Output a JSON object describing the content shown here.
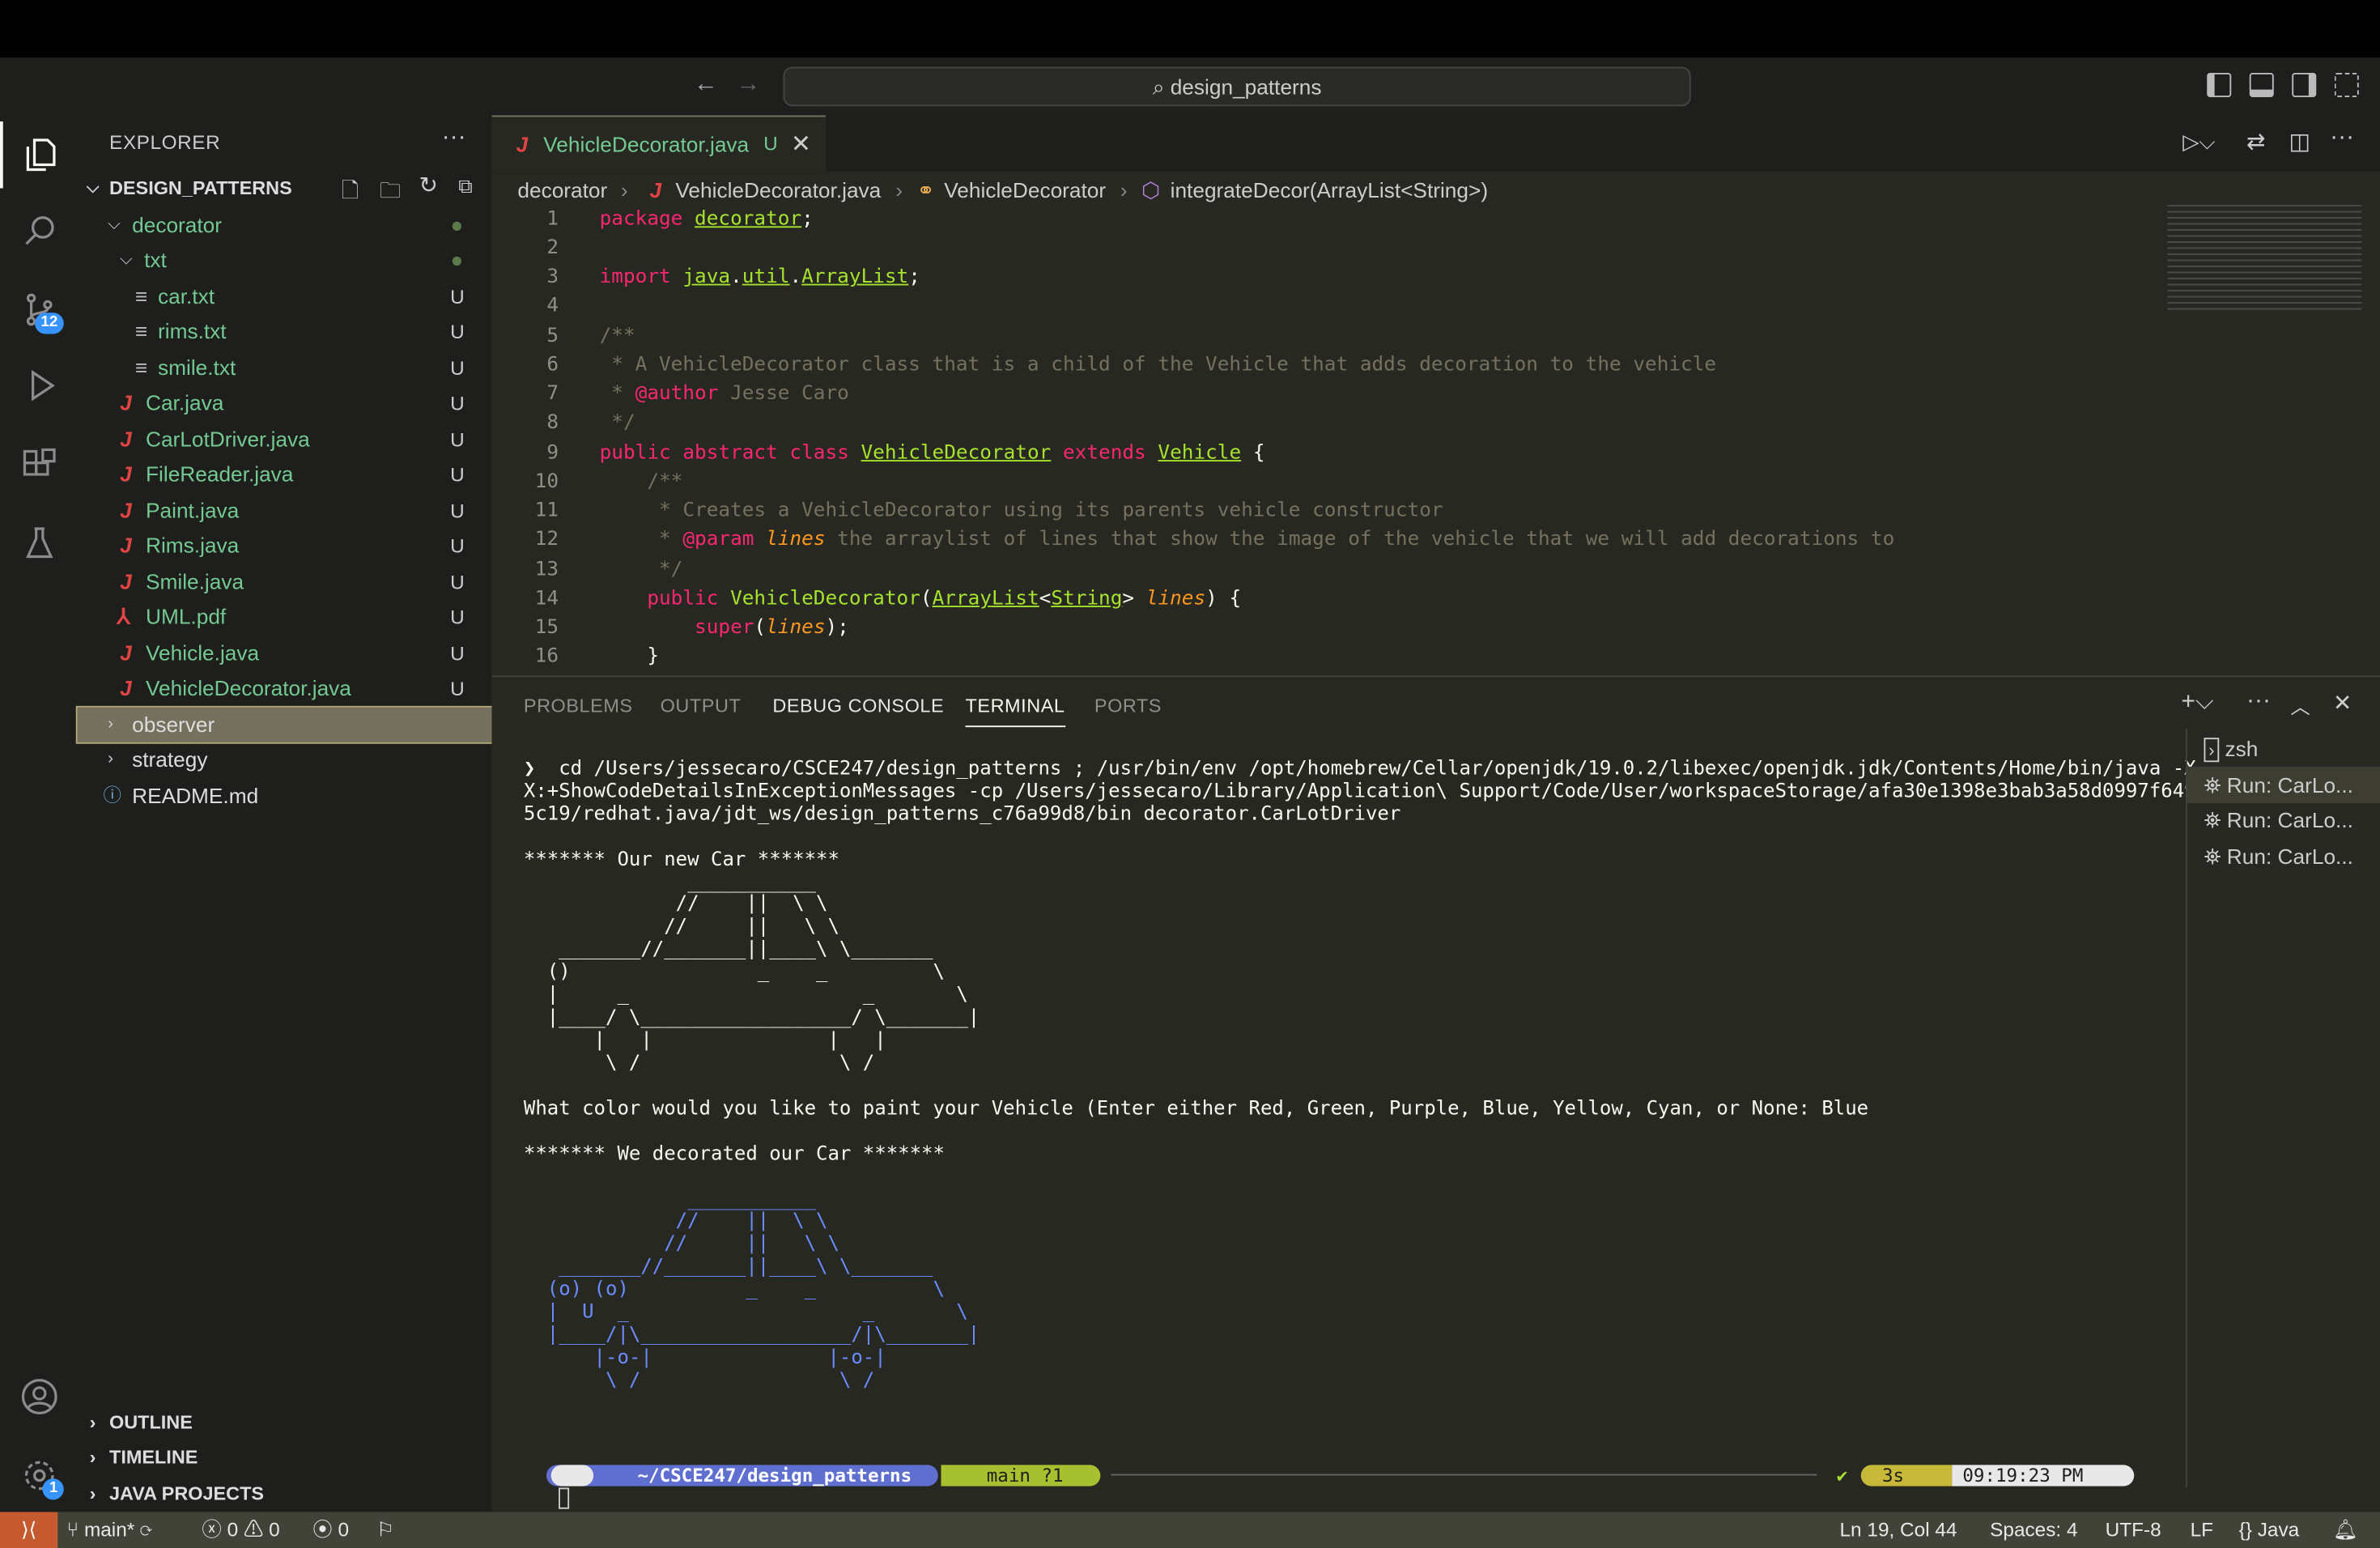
{
  "window": {
    "search": "design_patterns"
  },
  "activity": {
    "scm_badge": "12",
    "settings_badge": "1"
  },
  "sidebar": {
    "title": "EXPLORER",
    "root": "DESIGN_PATTERNS",
    "items": [
      {
        "label": "decorator",
        "status": ""
      },
      {
        "label": "txt",
        "status": ""
      },
      {
        "label": "car.txt",
        "status": "U"
      },
      {
        "label": "rims.txt",
        "status": "U"
      },
      {
        "label": "smile.txt",
        "status": "U"
      },
      {
        "label": "Car.java",
        "status": "U"
      },
      {
        "label": "CarLotDriver.java",
        "status": "U"
      },
      {
        "label": "FileReader.java",
        "status": "U"
      },
      {
        "label": "Paint.java",
        "status": "U"
      },
      {
        "label": "Rims.java",
        "status": "U"
      },
      {
        "label": "Smile.java",
        "status": "U"
      },
      {
        "label": "UML.pdf",
        "status": "U"
      },
      {
        "label": "Vehicle.java",
        "status": "U"
      },
      {
        "label": "VehicleDecorator.java",
        "status": "U"
      },
      {
        "label": "observer",
        "status": ""
      },
      {
        "label": "strategy",
        "status": ""
      },
      {
        "label": "README.md",
        "status": ""
      }
    ],
    "sections": [
      "OUTLINE",
      "TIMELINE",
      "JAVA PROJECTS"
    ]
  },
  "editor": {
    "tab": {
      "label": "VehicleDecorator.java",
      "status": "U"
    },
    "breadcrumb": [
      "decorator",
      "VehicleDecorator.java",
      "VehicleDecorator",
      "integrateDecor(ArrayList<String>)"
    ],
    "line_numbers": [
      "1",
      "2",
      "3",
      "4",
      "5",
      "6",
      "7",
      "8",
      "9",
      "10",
      "11",
      "12",
      "13",
      "14",
      "15",
      "16"
    ]
  },
  "panel": {
    "tabs": [
      "PROBLEMS",
      "OUTPUT",
      "DEBUG CONSOLE",
      "TERMINAL",
      "PORTS"
    ],
    "active_tab": "TERMINAL",
    "terminals": [
      "zsh",
      "Run: CarLo...",
      "Run: CarLo...",
      "Run: CarLo..."
    ],
    "output": "❯  cd /Users/jessecaro/CSCE247/design_patterns ; /usr/bin/env /opt/homebrew/Cellar/openjdk/19.0.2/libexec/openjdk.jdk/Contents/Home/bin/java -X\nX:+ShowCodeDetailsInExceptionMessages -cp /Users/jessecaro/Library/Application\\ Support/Code/User/workspaceStorage/afa30e1398e3bab3a58d0997f649\n5c19/redhat.java/jdt_ws/design_patterns_c76a99d8/bin decorator.CarLotDriver\n\n******* Our new Car *******",
    "car1": "              ___________\n             //    ||  \\ \\\n            //     ||   \\ \\\n   _______//_______||____\\ \\_______\n  ()                _    _         \\\n  |     _                    _       \\\n  |____/ \\__________________/ \\_______|\n      |   |               |   |\n       \\ /                 \\ /",
    "question": "What color would you like to paint your Vehicle (Enter either Red, Green, Purple, Blue, Yellow, Cyan, or None: Blue",
    "decorated": "******* We decorated our Car *******",
    "car2": "              ___________\n             //    ||  \\ \\\n            //     ||   \\ \\\n   _______//_______||____\\ \\_______\n  (o) (o)          _    _          \\\n  |  U  _                    _       \\\n  |____/|\\__________________/|\\_______|\n      |-o-|               |-o-|\n       \\ /                 \\ /",
    "prompt": {
      "path": "~/CSCE247/design_patterns",
      "branch": "main ?1",
      "duration": "3s",
      "time": "09:19:23 PM"
    }
  },
  "status": {
    "branch": "main*",
    "errors": "0",
    "warnings": "0",
    "ports": "0",
    "position": "Ln 19, Col 44",
    "spaces": "Spaces: 4",
    "encoding": "UTF-8",
    "eol": "LF",
    "language": "Java"
  },
  "colors": {
    "car2": "#6b8cff",
    "accent": "#f92672"
  }
}
